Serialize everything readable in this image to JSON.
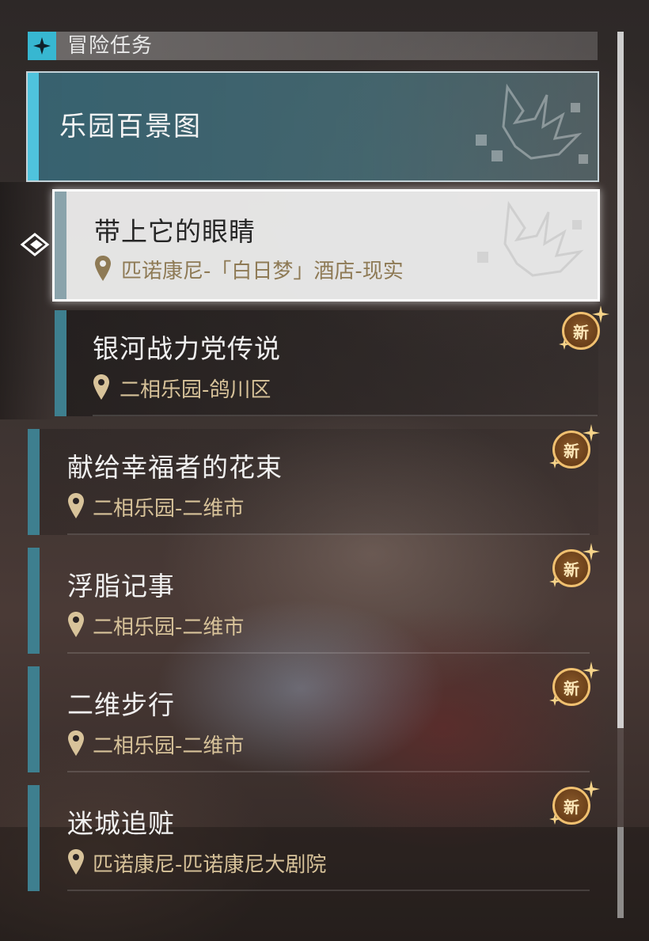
{
  "header": {
    "title": "冒险任务",
    "icon": "four-point-star-icon"
  },
  "category": {
    "title": "乐园百景图"
  },
  "quests": [
    {
      "title": "带上它的眼睛",
      "location": "匹诺康尼-「白日梦」酒店-现实",
      "selected": true,
      "new": false
    },
    {
      "title": "银河战力党传说",
      "location": "二相乐园-鸽川区",
      "selected": false,
      "new": true
    },
    {
      "title": "献给幸福者的花束",
      "location": "二相乐园-二维市",
      "selected": false,
      "new": true
    },
    {
      "title": "浮脂记事",
      "location": "二相乐园-二维市",
      "selected": false,
      "new": true
    },
    {
      "title": "二维步行",
      "location": "二相乐园-二维市",
      "selected": false,
      "new": true
    },
    {
      "title": "迷城追赃",
      "location": "匹诺康尼-匹诺康尼大剧院",
      "selected": false,
      "new": true
    }
  ],
  "badge": {
    "label": "新"
  },
  "colors": {
    "accent": "#4fc3dd",
    "bar": "#3e7f8f",
    "location": "#d8c39a",
    "badge": "#f0c070"
  }
}
